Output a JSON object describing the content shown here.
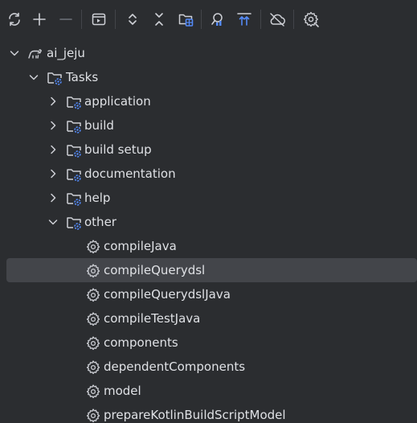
{
  "toolbar": {
    "buttons": [
      {
        "icon": "refresh-icon",
        "name": "reload-button"
      },
      {
        "icon": "plus-icon",
        "name": "add-button"
      },
      {
        "icon": "minus-icon",
        "name": "remove-button"
      },
      {
        "icon": "execute-task-icon",
        "name": "execute-task-button"
      },
      {
        "icon": "expand-all-icon",
        "name": "expand-all-button"
      },
      {
        "icon": "collapse-all-icon",
        "name": "collapse-all-button"
      },
      {
        "icon": "group-modules-icon",
        "name": "group-modules-button"
      },
      {
        "icon": "dependency-analyzer-icon",
        "name": "analyze-dependencies-button"
      },
      {
        "icon": "align-top-icon",
        "name": "align-top-button"
      },
      {
        "icon": "offline-mode-icon",
        "name": "offline-mode-button"
      },
      {
        "icon": "gear-icon",
        "name": "settings-button"
      }
    ]
  },
  "tree": {
    "project": {
      "label": "ai_jeju",
      "expanded": true
    },
    "tasks": {
      "label": "Tasks",
      "expanded": true
    },
    "groups": [
      {
        "label": "application",
        "expanded": false
      },
      {
        "label": "build",
        "expanded": false
      },
      {
        "label": "build setup",
        "expanded": false
      },
      {
        "label": "documentation",
        "expanded": false
      },
      {
        "label": "help",
        "expanded": false
      },
      {
        "label": "other",
        "expanded": true
      }
    ],
    "other_tasks": [
      {
        "label": "compileJava",
        "selected": false
      },
      {
        "label": "compileQuerydsl",
        "selected": true
      },
      {
        "label": "compileQuerydslJava",
        "selected": false
      },
      {
        "label": "compileTestJava",
        "selected": false
      },
      {
        "label": "components",
        "selected": false
      },
      {
        "label": "dependentComponents",
        "selected": false
      },
      {
        "label": "model",
        "selected": false
      },
      {
        "label": "prepareKotlinBuildScriptModel",
        "selected": false
      }
    ]
  },
  "colors": {
    "background": "#2b2d30",
    "selection": "#43454a",
    "text": "#dfe1e5",
    "icon": "#ced0d6",
    "accent": "#548af7"
  }
}
